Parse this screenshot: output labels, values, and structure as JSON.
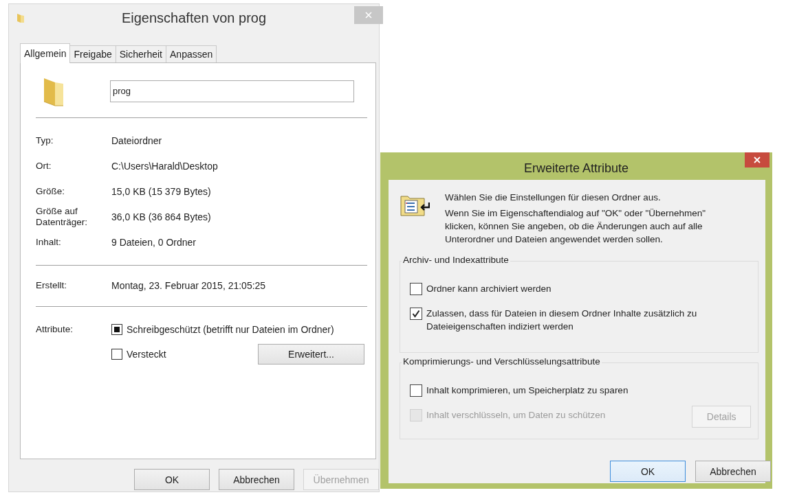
{
  "properties_dialog": {
    "title": "Eigenschaften von prog",
    "active": false,
    "tabs": [
      {
        "label": "Allgemein",
        "selected": true
      },
      {
        "label": "Freigabe",
        "selected": false
      },
      {
        "label": "Sicherheit",
        "selected": false
      },
      {
        "label": "Anpassen",
        "selected": false
      }
    ],
    "name_field": {
      "value": "prog"
    },
    "info_rows": [
      {
        "label": "Typ:",
        "value": "Dateiordner"
      },
      {
        "label": "Ort:",
        "value": "C:\\Users\\Harald\\Desktop"
      },
      {
        "label": "Größe:",
        "value": "15,0 KB (15 379 Bytes)"
      },
      {
        "label": "Größe auf Datenträger:",
        "value": "36,0 KB (36 864 Bytes)"
      },
      {
        "label": "Inhalt:",
        "value": "9 Dateien, 0 Ordner"
      }
    ],
    "created_row": {
      "label": "Erstellt:",
      "value": "Montag, 23. Februar 2015, 21:05:25"
    },
    "attributes": {
      "label": "Attribute:",
      "options": [
        {
          "label": "Schreibgeschützt (betrifft nur Dateien im Ordner)",
          "checked": false,
          "mixed": true
        },
        {
          "label": "Versteckt",
          "checked": false,
          "mixed": false
        }
      ],
      "advanced_button": "Erweitert..."
    },
    "buttons": [
      {
        "label": "OK",
        "disabled": false
      },
      {
        "label": "Abbrechen",
        "disabled": false
      },
      {
        "label": "Übernehmen",
        "disabled": true
      }
    ]
  },
  "advanced_dialog": {
    "title": "Erweiterte Attribute",
    "active": true,
    "intro": "Wählen Sie die Einstellungen für diesen Ordner aus.",
    "description": "Wenn Sie im Eigenschaftendialog auf \"OK\" oder \"Übernehmen\" klicken, können Sie angeben, ob die Änderungen auch auf alle Unterordner und Dateien angewendet werden sollen.",
    "groups": [
      {
        "title": "Archiv- und Indexattribute",
        "options": [
          {
            "label": "Ordner kann archiviert werden",
            "checked": false,
            "disabled": false
          },
          {
            "label": "Zulassen, dass für Dateien in diesem Ordner Inhalte zusätzlich zu Dateieigenschaften indiziert werden",
            "checked": true,
            "disabled": false
          }
        ]
      },
      {
        "title": "Komprimierungs- und Verschlüsselungsattribute",
        "options": [
          {
            "label": "Inhalt komprimieren, um Speicherplatz zu sparen",
            "checked": false,
            "disabled": false
          },
          {
            "label": "Inhalt verschlüsseln, um Daten zu schützen",
            "checked": false,
            "disabled": true,
            "button": {
              "label": "Details",
              "disabled": true
            }
          }
        ]
      }
    ],
    "buttons": [
      {
        "label": "OK",
        "default": true
      },
      {
        "label": "Abbrechen",
        "default": false
      }
    ]
  }
}
